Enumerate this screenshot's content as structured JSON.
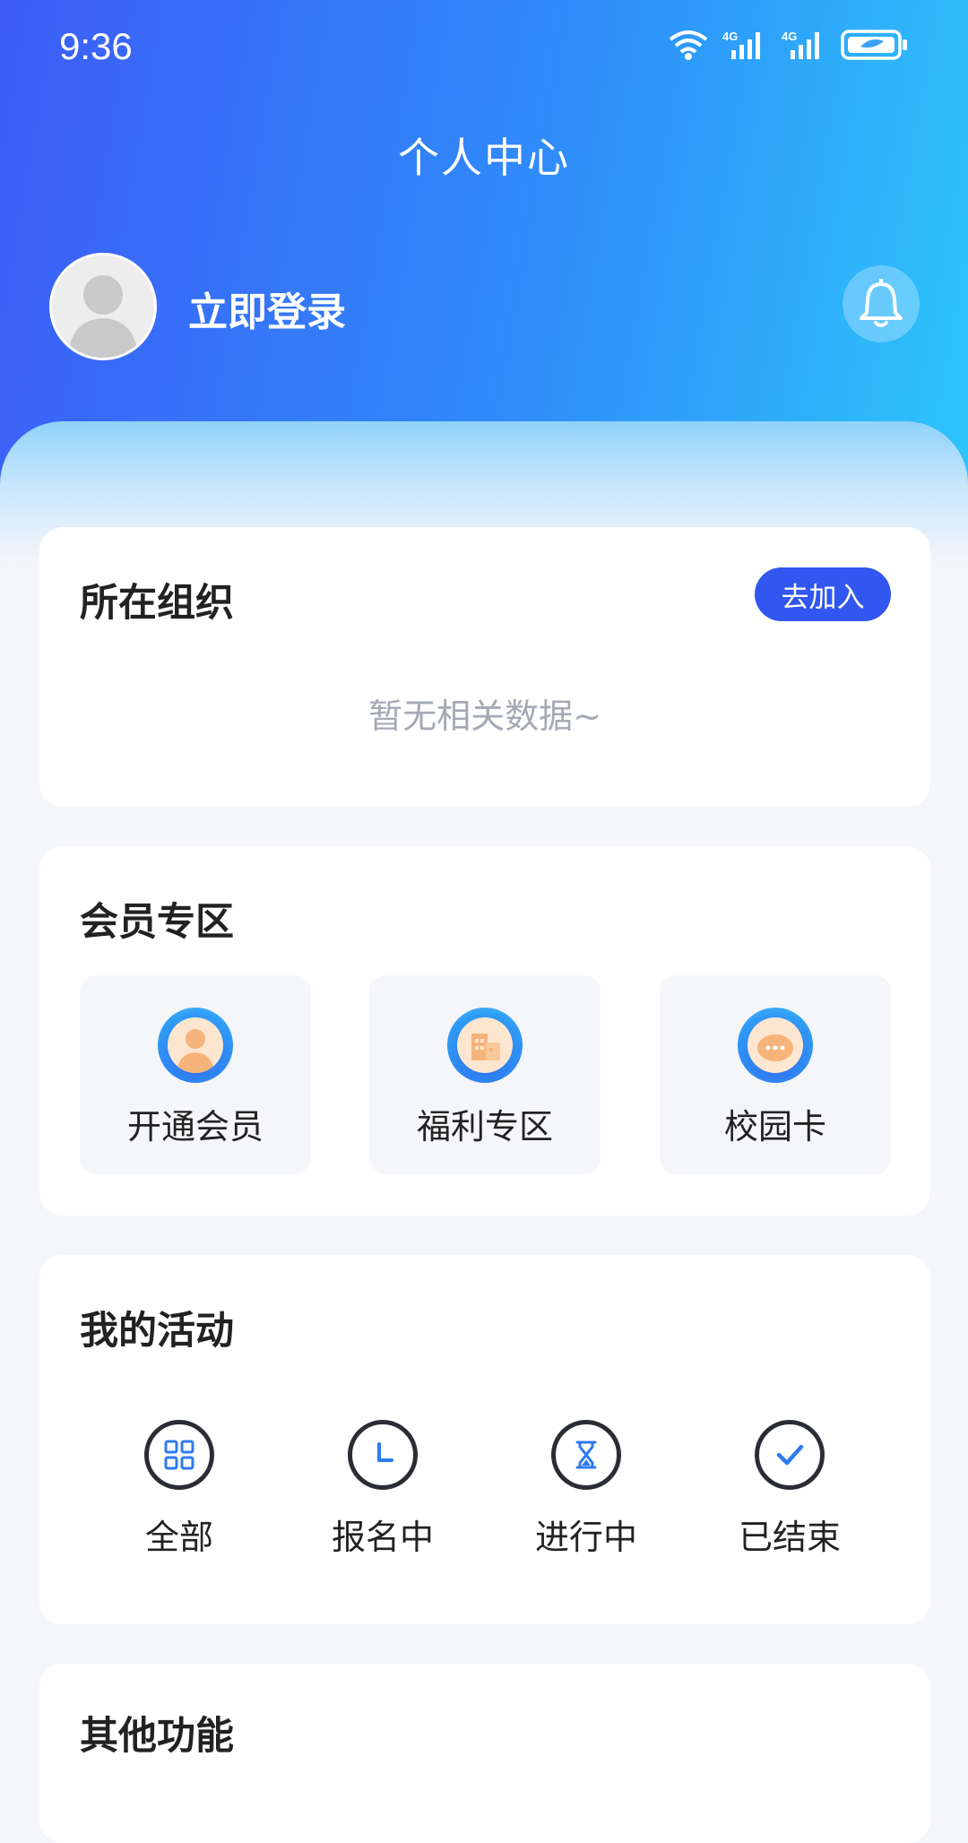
{
  "status_bar": {
    "time": "9:36",
    "icons": [
      "wifi-icon",
      "signal-4g-icon",
      "signal-4g-icon",
      "battery-icon"
    ]
  },
  "header": {
    "title": "个人中心",
    "login_text": "立即登录",
    "avatar_icon": "default-avatar-icon",
    "bell_icon": "bell-icon"
  },
  "organization": {
    "title": "所在组织",
    "join_label": "去加入",
    "empty_text": "暂无相关数据~"
  },
  "membership": {
    "title": "会员专区",
    "items": [
      {
        "label": "开通会员",
        "icon": "member-person-icon"
      },
      {
        "label": "福利专区",
        "icon": "welfare-building-icon"
      },
      {
        "label": "校园卡",
        "icon": "campus-card-icon"
      }
    ]
  },
  "activities": {
    "title": "我的活动",
    "items": [
      {
        "label": "全部",
        "icon": "grid-icon"
      },
      {
        "label": "报名中",
        "icon": "clock-icon"
      },
      {
        "label": "进行中",
        "icon": "hourglass-icon"
      },
      {
        "label": "已结束",
        "icon": "check-icon"
      }
    ]
  },
  "other": {
    "title": "其他功能"
  },
  "colors": {
    "header_gradient_start": "#3d5cf7",
    "header_gradient_end": "#2dc6fb",
    "accent": "#3157f0",
    "background": "#f5f6fa"
  }
}
